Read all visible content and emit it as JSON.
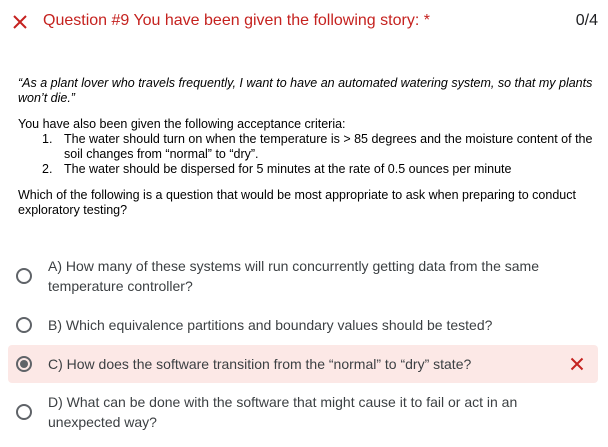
{
  "header": {
    "title": "Question #9 You have been given the following story: *",
    "score": "0/4",
    "status_icon": "close-icon",
    "status_color": "#c5221f"
  },
  "question": {
    "story": "“As a plant lover who travels frequently, I want to have an automated watering system, so that my plants won’t die.”",
    "criteria_intro": "You have also been given the following acceptance criteria:",
    "criteria": [
      {
        "num": "1.",
        "text": "The water should turn on when the temperature is > 85 degrees and the moisture content of the soil changes from “normal” to “dry”."
      },
      {
        "num": "2.",
        "text": "The water should be dispersed for 5 minutes at the rate of 0.5 ounces per minute"
      }
    ],
    "prompt": "Which of the following is a question that would be most appropriate to ask when preparing to conduct exploratory testing?"
  },
  "options": [
    {
      "label": "A) How many of these systems will run concurrently getting data from the same temperature controller?",
      "selected": false
    },
    {
      "label": "B) Which equivalence partitions and boundary values should be tested?",
      "selected": false
    },
    {
      "label": "C) How does the software transition from the “normal” to “dry” state?",
      "selected": true,
      "result_icon": "close-icon",
      "highlight_color": "#fce8e6"
    },
    {
      "label": "D) What can be done with the software that might cause it to fail or act in an unexpected way?",
      "selected": false
    }
  ]
}
